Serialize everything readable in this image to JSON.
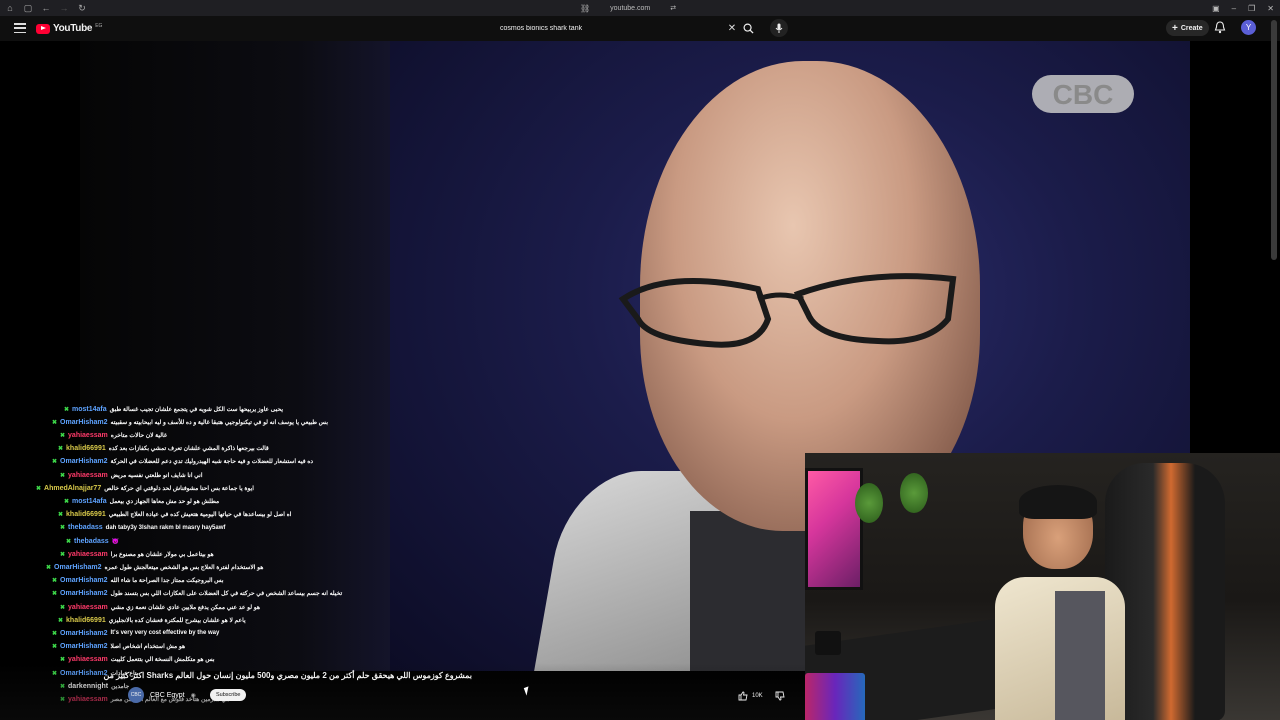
{
  "browser": {
    "url": "youtube.com"
  },
  "header": {
    "logo_text": "YouTube",
    "logo_country": "EG",
    "search_value": "cosmos bionics shark tank",
    "create_label": "Create",
    "avatar_letter": "Y"
  },
  "video": {
    "channel_logo_text": "CBC",
    "title": "بمشروع كوزموس اللي هيحقق حلم أكتر من 2 مليون مصري و500 مليون إنسان حول العالم Sharks اكتر كبير من",
    "channel_name": "CBC Egypt",
    "subscribe_label": "Subscribe",
    "like_count": "10K"
  },
  "chat": {
    "messages": [
      {
        "user": "most14afa",
        "color": "#5ea3ff",
        "text": "يحبى عاوز يربيحها ست الكل شويه في يتجمع علشان تجيب غسالة طبق"
      },
      {
        "user": "OmarHisham2",
        "color": "#5ea3ff",
        "text": "بس طبيعي يا يوسف انه لو في تيكنولوجيي هتبقا غالية و ده للأسف و ليه ابيحابيته و سقبيته"
      },
      {
        "user": "yahiaessam",
        "color": "#ff3a6a",
        "text": "غالية لان حالات متاخره"
      },
      {
        "user": "khalid66991",
        "color": "#d8c94a",
        "text": "قالت بيرجعها ذاكرة المشي علشان تعرف تمشي بكفازات بعد كده"
      },
      {
        "user": "OmarHisham2",
        "color": "#5ea3ff",
        "text": "ده فيه استشعار للعضلات و فيه حاجة شبه الهيدروليك تدي دعم للعضلات في الحركة"
      },
      {
        "user": "yahiaessam",
        "color": "#ff3a6a",
        "text": "اني انا شايف انو طلعتي نفسيه مريض"
      },
      {
        "user": "AhmedAlnajjar77",
        "color": "#d8c94a",
        "text": "ايوة يا جماعة بس احنا مشوفناش لحد دلوقتي اي حركة خالص"
      },
      {
        "user": "most14afa",
        "color": "#5ea3ff",
        "text": "مطلش هو لو حد مش معاها الجهاز دي بيعمل"
      },
      {
        "user": "khalid66991",
        "color": "#d8c94a",
        "text": "اه اصل لو بيساعدها في حياتها اليومية هتعيش كده في عيادة العلاج الطبيعي"
      },
      {
        "user": "thebadass",
        "color": "#5ea3ff",
        "text": "dah taby3y 3lshan rakm bl masry hay5awf"
      },
      {
        "user": "thebadass",
        "color": "#5ea3ff",
        "text": "😈"
      },
      {
        "user": "yahiaessam",
        "color": "#ff3a6a",
        "text": "هو بيتاعمل بي مولار علشان هو مصنوع برا"
      },
      {
        "user": "OmarHisham2",
        "color": "#5ea3ff",
        "text": "هو الاستخدام لفترة العلاج بس هو الشخص ميتعالجش طول عمره"
      },
      {
        "user": "OmarHisham2",
        "color": "#5ea3ff",
        "text": "بس البروجيكت ممتاز جدا الصراحة ما شاء الله"
      },
      {
        "user": "OmarHisham2",
        "color": "#5ea3ff",
        "text": "تخيله انه جسم بيساعد الشخص في حركته في كل العضلات على العكازات اللي بس بتسند طول"
      },
      {
        "user": "yahiaessam",
        "color": "#ff3a6a",
        "text": "هو لو عد عني ممكن يدفع ملايين عادي علشان نعمة زي مشي"
      },
      {
        "user": "khalid66991",
        "color": "#d8c94a",
        "text": "ياعم لا هو علشان بيشرح للمكترة فعشان كده بالانجليزي"
      },
      {
        "user": "OmarHisham2",
        "color": "#5ea3ff",
        "text": "It's very very cost effective by the way"
      },
      {
        "user": "OmarHisham2",
        "color": "#5ea3ff",
        "text": "هو مش استخدام اشخاص اصلا"
      },
      {
        "user": "yahiaessam",
        "color": "#ff3a6a",
        "text": "بس هو متكلمش النسخة الي بتتعمل كليبت"
      },
      {
        "user": "OmarHisham2",
        "color": "#5ea3ff",
        "text": "بتاع عيادات"
      },
      {
        "user": "darkennight",
        "color": "#ffffff",
        "text": "جامدين"
      },
      {
        "user": "yahiaessam",
        "color": "#ff3a6a",
        "text": "هي مدرمين هتاخد فلوس مع العالم اكتر من مصر"
      }
    ]
  },
  "colors": {
    "accent": "#ff0033",
    "bg": "#0f0f0f",
    "chat_badge": "#3dd84a"
  }
}
